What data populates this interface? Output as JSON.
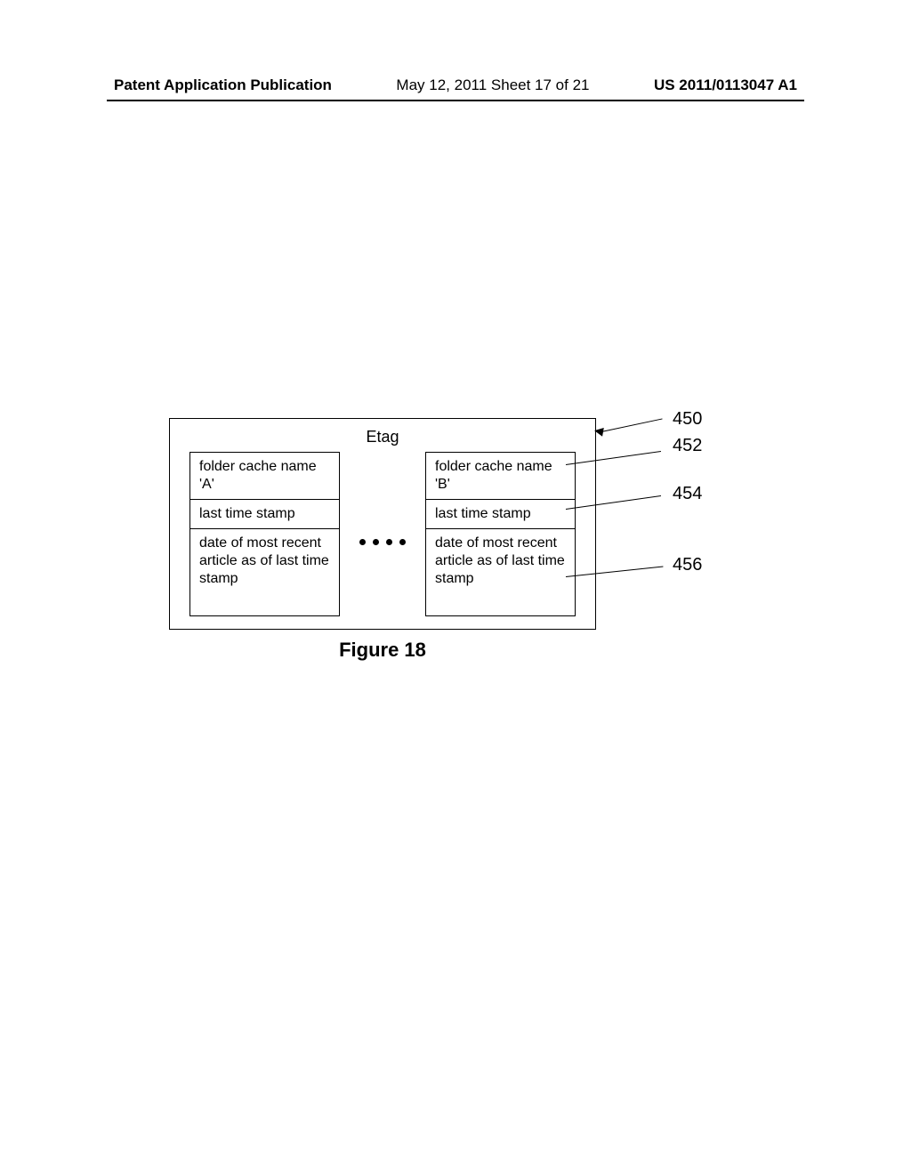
{
  "header": {
    "left": "Patent Application Publication",
    "mid": "May 12, 2011   Sheet 17 of 21",
    "right": "US 2011/0113047 A1"
  },
  "figure": {
    "title": "Etag",
    "caption": "Figure 18",
    "columns": [
      {
        "name": "folder cache name 'A'",
        "timestamp": "last time stamp",
        "date": "date of most recent article as of last time stamp"
      },
      {
        "name": "folder cache name 'B'",
        "timestamp": "last time stamp",
        "date": "date of most recent article as of last time stamp"
      }
    ],
    "refs": {
      "box": "450",
      "name": "452",
      "timestamp": "454",
      "date": "456"
    }
  }
}
